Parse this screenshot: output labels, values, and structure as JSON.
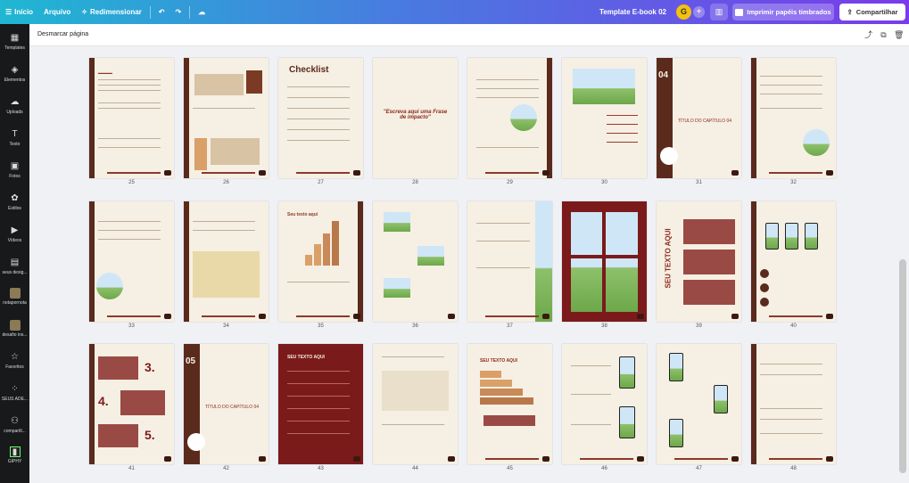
{
  "topbar": {
    "inicio": "Início",
    "arquivo": "Arquivo",
    "redimensionar": "Redimensionar",
    "title": "Template E-book 02",
    "avatar": "G",
    "print": "Imprimir papéis timbrados",
    "share": "Compartilhar"
  },
  "sidebar": {
    "items": [
      "Templates",
      "Elementos",
      "Uploads",
      "Texto",
      "Fotos",
      "Estilos",
      "Vídeos",
      "seus desig...",
      "notapornota",
      "desafio ins...",
      "Favoritos",
      "SEUS ADE...",
      "compartil...",
      "GIPHY"
    ]
  },
  "subbar": {
    "deselect": "Desmarcar página"
  },
  "pages": [
    "25",
    "26",
    "27",
    "28",
    "29",
    "30",
    "31",
    "32",
    "33",
    "34",
    "35",
    "36",
    "37",
    "38",
    "39",
    "40",
    "41",
    "42",
    "43",
    "44",
    "45",
    "46",
    "47",
    "48"
  ],
  "page_text": {
    "p27": "Checklist",
    "p28": "\"Escreva aqui uma Frase de impacto\"",
    "p31": "TÍTULO DO CAPÍTULO 04",
    "p31num": "04",
    "p35": "Seu texto aqui",
    "p39": "SEU TEXTO AQUI",
    "p41a": "3.",
    "p41b": "4.",
    "p41c": "5.",
    "p42": "TÍTULO DO CAPÍTULO 04",
    "p42num": "05",
    "p43": "SEU TEXTO AQUI",
    "p45": "SEU TEXTO AQUI",
    "logo": "SUA LOGO AQUI"
  },
  "colors": {
    "brown": "#5a2a1c",
    "maroon": "#7b1a1a",
    "paper": "#f6efe3"
  }
}
